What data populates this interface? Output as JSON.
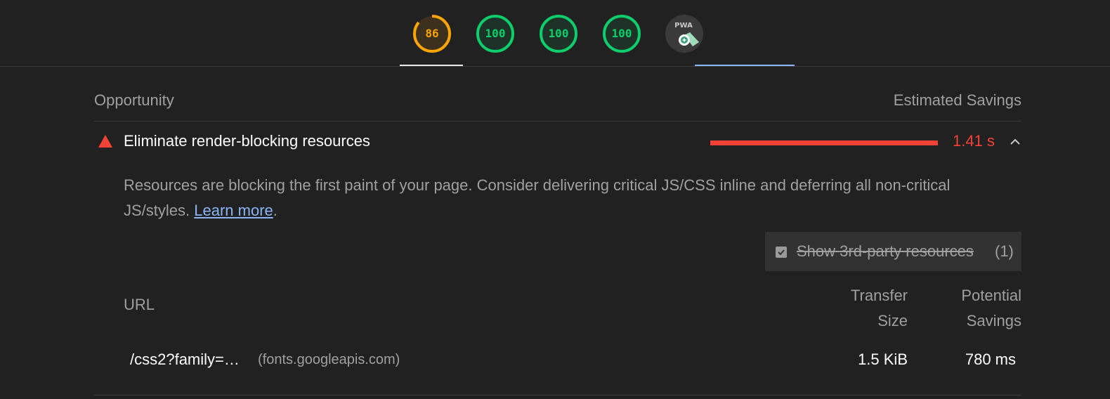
{
  "colors": {
    "average": "#ffa400",
    "pass": "#0cce6b",
    "fail": "#f44336",
    "link": "#8ab4f8"
  },
  "scores": [
    {
      "value": "86",
      "status": "average",
      "fraction": 0.86
    },
    {
      "value": "100",
      "status": "pass",
      "fraction": 1.0
    },
    {
      "value": "100",
      "status": "pass",
      "fraction": 1.0
    },
    {
      "value": "100",
      "status": "pass",
      "fraction": 1.0
    }
  ],
  "pwa_badge": {
    "label": "PWA",
    "icon": "pwa-badge-icon"
  },
  "table_header": {
    "opportunity": "Opportunity",
    "estimated_savings": "Estimated Savings"
  },
  "audit": {
    "title": "Eliminate render-blocking resources",
    "savings": "1.41 s",
    "savings_fraction": 1.0,
    "description": "Resources are blocking the first paint of your page. Consider delivering critical JS/CSS inline and deferring all non-critical JS/styles.",
    "learn_more": "Learn more",
    "period": "."
  },
  "third_party": {
    "label": "Show 3rd-party resources",
    "count": "(1)",
    "checked": true
  },
  "columns": {
    "url": "URL",
    "transfer_size": "Transfer Size",
    "potential_savings": "Potential Savings"
  },
  "rows": [
    {
      "url": "/css2?family=…",
      "host": "(fonts.googleapis.com)",
      "transfer_size": "1.5 KiB",
      "potential_savings": "780 ms"
    }
  ]
}
